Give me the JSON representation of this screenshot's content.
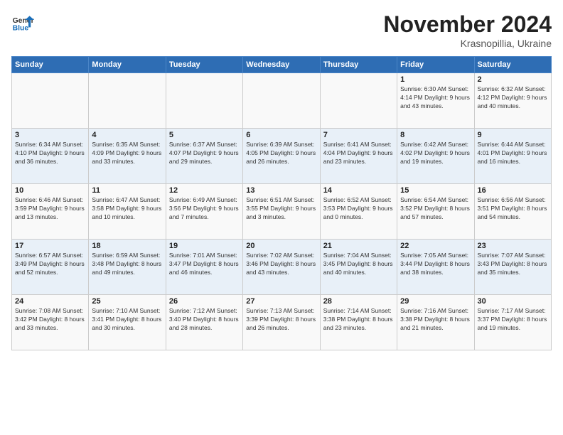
{
  "logo": {
    "general": "General",
    "blue": "Blue"
  },
  "header": {
    "title": "November 2024",
    "subtitle": "Krasnopillia, Ukraine"
  },
  "weekdays": [
    "Sunday",
    "Monday",
    "Tuesday",
    "Wednesday",
    "Thursday",
    "Friday",
    "Saturday"
  ],
  "weeks": [
    [
      {
        "day": "",
        "info": ""
      },
      {
        "day": "",
        "info": ""
      },
      {
        "day": "",
        "info": ""
      },
      {
        "day": "",
        "info": ""
      },
      {
        "day": "",
        "info": ""
      },
      {
        "day": "1",
        "info": "Sunrise: 6:30 AM\nSunset: 4:14 PM\nDaylight: 9 hours\nand 43 minutes."
      },
      {
        "day": "2",
        "info": "Sunrise: 6:32 AM\nSunset: 4:12 PM\nDaylight: 9 hours\nand 40 minutes."
      }
    ],
    [
      {
        "day": "3",
        "info": "Sunrise: 6:34 AM\nSunset: 4:10 PM\nDaylight: 9 hours\nand 36 minutes."
      },
      {
        "day": "4",
        "info": "Sunrise: 6:35 AM\nSunset: 4:09 PM\nDaylight: 9 hours\nand 33 minutes."
      },
      {
        "day": "5",
        "info": "Sunrise: 6:37 AM\nSunset: 4:07 PM\nDaylight: 9 hours\nand 29 minutes."
      },
      {
        "day": "6",
        "info": "Sunrise: 6:39 AM\nSunset: 4:05 PM\nDaylight: 9 hours\nand 26 minutes."
      },
      {
        "day": "7",
        "info": "Sunrise: 6:41 AM\nSunset: 4:04 PM\nDaylight: 9 hours\nand 23 minutes."
      },
      {
        "day": "8",
        "info": "Sunrise: 6:42 AM\nSunset: 4:02 PM\nDaylight: 9 hours\nand 19 minutes."
      },
      {
        "day": "9",
        "info": "Sunrise: 6:44 AM\nSunset: 4:01 PM\nDaylight: 9 hours\nand 16 minutes."
      }
    ],
    [
      {
        "day": "10",
        "info": "Sunrise: 6:46 AM\nSunset: 3:59 PM\nDaylight: 9 hours\nand 13 minutes."
      },
      {
        "day": "11",
        "info": "Sunrise: 6:47 AM\nSunset: 3:58 PM\nDaylight: 9 hours\nand 10 minutes."
      },
      {
        "day": "12",
        "info": "Sunrise: 6:49 AM\nSunset: 3:56 PM\nDaylight: 9 hours\nand 7 minutes."
      },
      {
        "day": "13",
        "info": "Sunrise: 6:51 AM\nSunset: 3:55 PM\nDaylight: 9 hours\nand 3 minutes."
      },
      {
        "day": "14",
        "info": "Sunrise: 6:52 AM\nSunset: 3:53 PM\nDaylight: 9 hours\nand 0 minutes."
      },
      {
        "day": "15",
        "info": "Sunrise: 6:54 AM\nSunset: 3:52 PM\nDaylight: 8 hours\nand 57 minutes."
      },
      {
        "day": "16",
        "info": "Sunrise: 6:56 AM\nSunset: 3:51 PM\nDaylight: 8 hours\nand 54 minutes."
      }
    ],
    [
      {
        "day": "17",
        "info": "Sunrise: 6:57 AM\nSunset: 3:49 PM\nDaylight: 8 hours\nand 52 minutes."
      },
      {
        "day": "18",
        "info": "Sunrise: 6:59 AM\nSunset: 3:48 PM\nDaylight: 8 hours\nand 49 minutes."
      },
      {
        "day": "19",
        "info": "Sunrise: 7:01 AM\nSunset: 3:47 PM\nDaylight: 8 hours\nand 46 minutes."
      },
      {
        "day": "20",
        "info": "Sunrise: 7:02 AM\nSunset: 3:46 PM\nDaylight: 8 hours\nand 43 minutes."
      },
      {
        "day": "21",
        "info": "Sunrise: 7:04 AM\nSunset: 3:45 PM\nDaylight: 8 hours\nand 40 minutes."
      },
      {
        "day": "22",
        "info": "Sunrise: 7:05 AM\nSunset: 3:44 PM\nDaylight: 8 hours\nand 38 minutes."
      },
      {
        "day": "23",
        "info": "Sunrise: 7:07 AM\nSunset: 3:43 PM\nDaylight: 8 hours\nand 35 minutes."
      }
    ],
    [
      {
        "day": "24",
        "info": "Sunrise: 7:08 AM\nSunset: 3:42 PM\nDaylight: 8 hours\nand 33 minutes."
      },
      {
        "day": "25",
        "info": "Sunrise: 7:10 AM\nSunset: 3:41 PM\nDaylight: 8 hours\nand 30 minutes."
      },
      {
        "day": "26",
        "info": "Sunrise: 7:12 AM\nSunset: 3:40 PM\nDaylight: 8 hours\nand 28 minutes."
      },
      {
        "day": "27",
        "info": "Sunrise: 7:13 AM\nSunset: 3:39 PM\nDaylight: 8 hours\nand 26 minutes."
      },
      {
        "day": "28",
        "info": "Sunrise: 7:14 AM\nSunset: 3:38 PM\nDaylight: 8 hours\nand 23 minutes."
      },
      {
        "day": "29",
        "info": "Sunrise: 7:16 AM\nSunset: 3:38 PM\nDaylight: 8 hours\nand 21 minutes."
      },
      {
        "day": "30",
        "info": "Sunrise: 7:17 AM\nSunset: 3:37 PM\nDaylight: 8 hours\nand 19 minutes."
      }
    ]
  ]
}
